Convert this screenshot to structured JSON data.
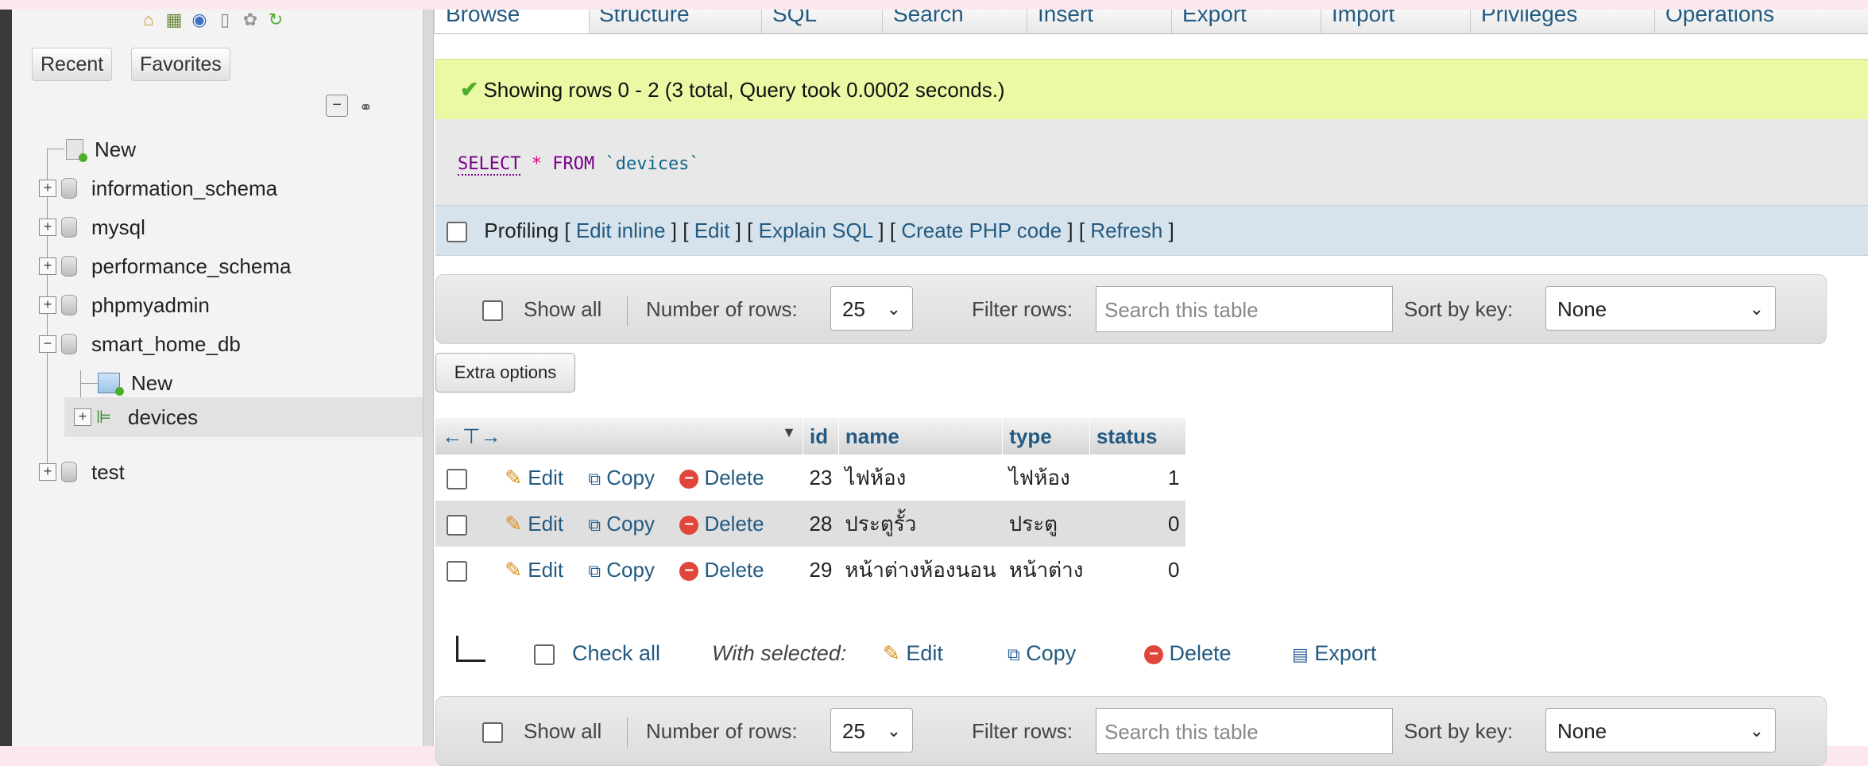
{
  "nav": {
    "recent_label": "Recent",
    "favorites_label": "Favorites",
    "tree": [
      {
        "label": "New"
      },
      {
        "label": "information_schema"
      },
      {
        "label": "mysql"
      },
      {
        "label": "performance_schema"
      },
      {
        "label": "phpmyadmin"
      },
      {
        "label": "smart_home_db"
      },
      {
        "label": "New"
      },
      {
        "label": "devices"
      },
      {
        "label": "test"
      }
    ]
  },
  "tabs": [
    "Browse",
    "Structure",
    "SQL",
    "Search",
    "Insert",
    "Export",
    "Import",
    "Privileges",
    "Operations"
  ],
  "success_message": "Showing rows 0 - 2 (3 total, Query took 0.0002 seconds.)",
  "sql": {
    "select": "SELECT",
    "star": "*",
    "from": "FROM",
    "table": "`devices`"
  },
  "profiling": {
    "label": "Profiling",
    "links": [
      "Edit inline",
      "Edit",
      "Explain SQL",
      "Create PHP code",
      "Refresh"
    ]
  },
  "controls": {
    "show_all": "Show all",
    "number_of_rows_label": "Number of rows:",
    "number_of_rows_value": "25",
    "filter_label": "Filter rows:",
    "filter_placeholder": "Search this table",
    "sort_label": "Sort by key:",
    "sort_value": "None"
  },
  "extra_options": "Extra options",
  "table": {
    "columns": [
      "id",
      "name",
      "type",
      "status"
    ],
    "actions": {
      "edit": "Edit",
      "copy": "Copy",
      "delete": "Delete"
    },
    "rows": [
      {
        "id": "23",
        "name": "ไฟห้อง",
        "type": "ไฟห้อง",
        "status": "1"
      },
      {
        "id": "28",
        "name": "ประตูรั้ว",
        "type": "ประตู",
        "status": "0"
      },
      {
        "id": "29",
        "name": "หน้าต่างห้องนอน",
        "type": "หน้าต่าง",
        "status": "0"
      }
    ]
  },
  "bulk": {
    "check_all": "Check all",
    "with_selected": "With selected:",
    "edit": "Edit",
    "copy": "Copy",
    "delete": "Delete",
    "export": "Export"
  },
  "colors": {
    "link": "#235a81",
    "success_bg": "#ebf8a4",
    "profiling_bg": "#d7e3ec"
  }
}
